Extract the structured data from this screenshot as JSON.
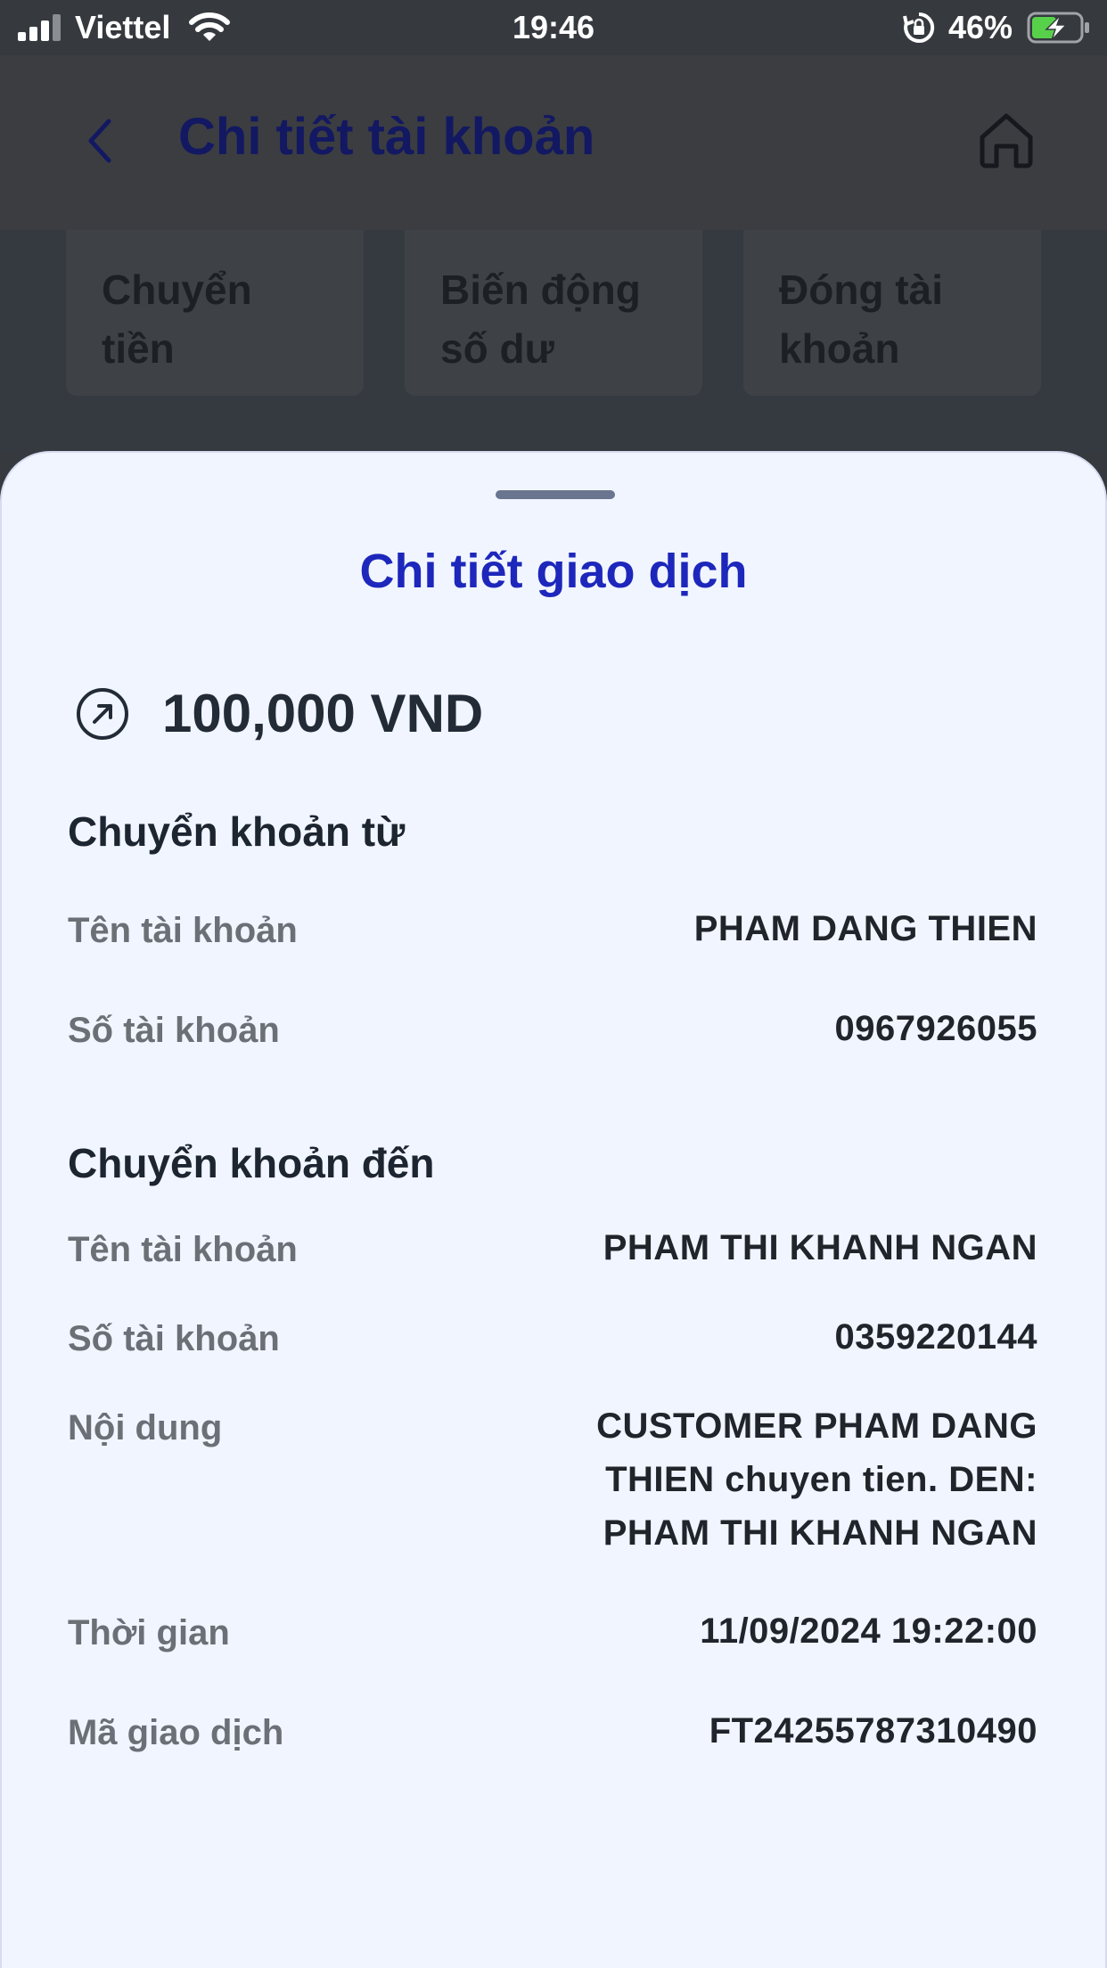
{
  "status_bar": {
    "carrier": "Viettel",
    "time": "19:46",
    "battery_percent": "46%",
    "icons": [
      "signal-icon",
      "wifi-icon",
      "rotation-lock-icon",
      "battery-charging-icon"
    ]
  },
  "header": {
    "title": "Chi tiết tài khoản",
    "back_icon": "chevron-left-icon",
    "home_icon": "home-icon"
  },
  "actions": [
    {
      "line1": "Chuyển",
      "line2": "tiền"
    },
    {
      "line1": "Biến động",
      "line2": "số dư"
    },
    {
      "line1": "Đóng tài",
      "line2": "khoản"
    }
  ],
  "sheet": {
    "title": "Chi tiết giao dịch",
    "amount_icon": "arrow-up-right-circle-icon",
    "amount": "100,000 VND",
    "from": {
      "section_title": "Chuyển khoản từ",
      "name_label": "Tên tài khoản",
      "name_value": "PHAM DANG THIEN",
      "number_label": "Số tài khoản",
      "number_value": "0967926055"
    },
    "to": {
      "section_title": "Chuyển khoản đến",
      "name_label": "Tên tài khoản",
      "name_value": "PHAM THI KHANH NGAN",
      "number_label": "Số tài khoản",
      "number_value": "0359220144"
    },
    "content_label": "Nội dung",
    "content_value_lines": [
      "CUSTOMER PHAM DANG",
      "THIEN chuyen tien. DEN:",
      "PHAM THI KHANH NGAN"
    ],
    "time_label": "Thời gian",
    "time_value": "11/09/2024 19:22:00",
    "ref_label": "Mã giao dịch",
    "ref_value": "FT24255787310490"
  },
  "colors": {
    "sheet_bg": "#f1f5ff",
    "title_blue": "#1d27bb",
    "overlay_dark": "#363a3f"
  }
}
